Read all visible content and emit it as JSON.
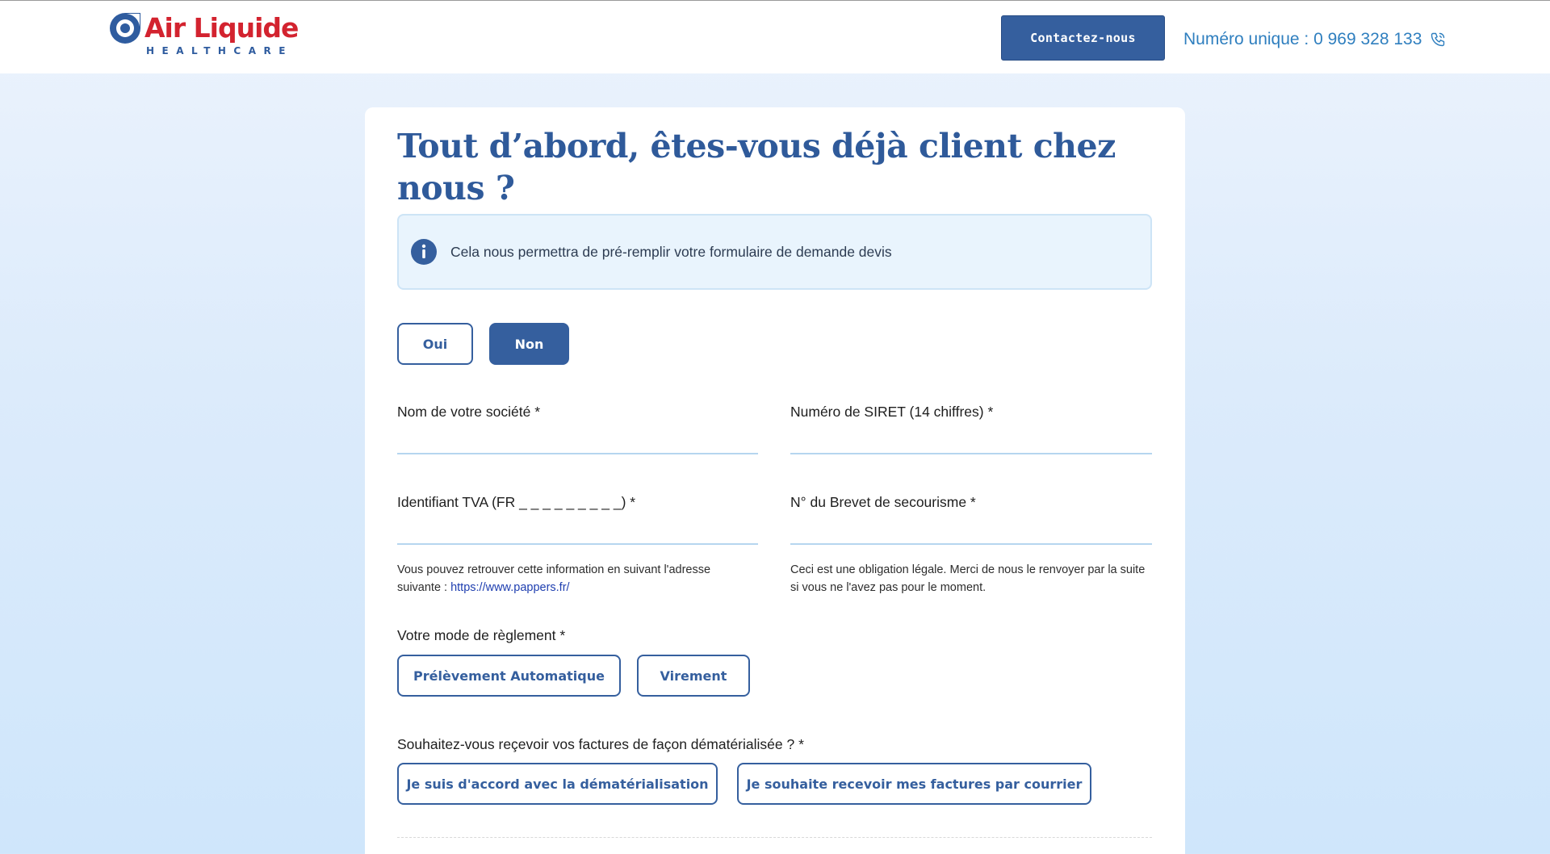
{
  "header": {
    "logo": {
      "name": "Air Liquide",
      "subtitle": "HEALTHCARE"
    },
    "contact_button": "Contactez-nous",
    "phone_text": "Numéro unique : 0 969 328 133",
    "phone_icon": "phone-icon"
  },
  "form": {
    "title": "Tout d’abord, êtes-vous déjà client chez nous ?",
    "info": {
      "icon": "info-icon",
      "text": "Cela nous permettra de pré-remplir votre formulaire de demande devis"
    },
    "client_choice": {
      "options": [
        "Oui",
        "Non"
      ],
      "selected": "Non"
    },
    "fields": {
      "company": {
        "label": "Nom de votre société *",
        "value": ""
      },
      "siret": {
        "label": "Numéro de SIRET (14 chiffres) *",
        "value": ""
      },
      "tva": {
        "label": "Identifiant TVA (FR _ _ _ _ _ _ _ _ _) *",
        "value": "",
        "help_text": "Vous pouvez retrouver cette information en suivant l'adresse suivante : ",
        "help_link": "https://www.pappers.fr/"
      },
      "brevet": {
        "label": "N° du Brevet de secourisme *",
        "value": "",
        "help_text": "Ceci est une obligation légale. Merci de nous le renvoyer par la suite si vous ne l'avez pas pour le moment."
      }
    },
    "payment": {
      "label": "Votre mode de règlement *",
      "options": [
        "Prélèvement Automatique",
        "Virement"
      ]
    },
    "invoices": {
      "label": "Souhaitez-vous reçevoir vos factures de façon dématérialisée ? *",
      "options": [
        "Je suis d'accord avec la dématérialisation",
        "Je souhaite recevoir mes factures par courrier"
      ]
    }
  },
  "colors": {
    "brand_blue": "#355f9e",
    "brand_red": "#d3232f",
    "title_blue": "#2f5a9a",
    "link_blue": "#2f7fbf"
  }
}
